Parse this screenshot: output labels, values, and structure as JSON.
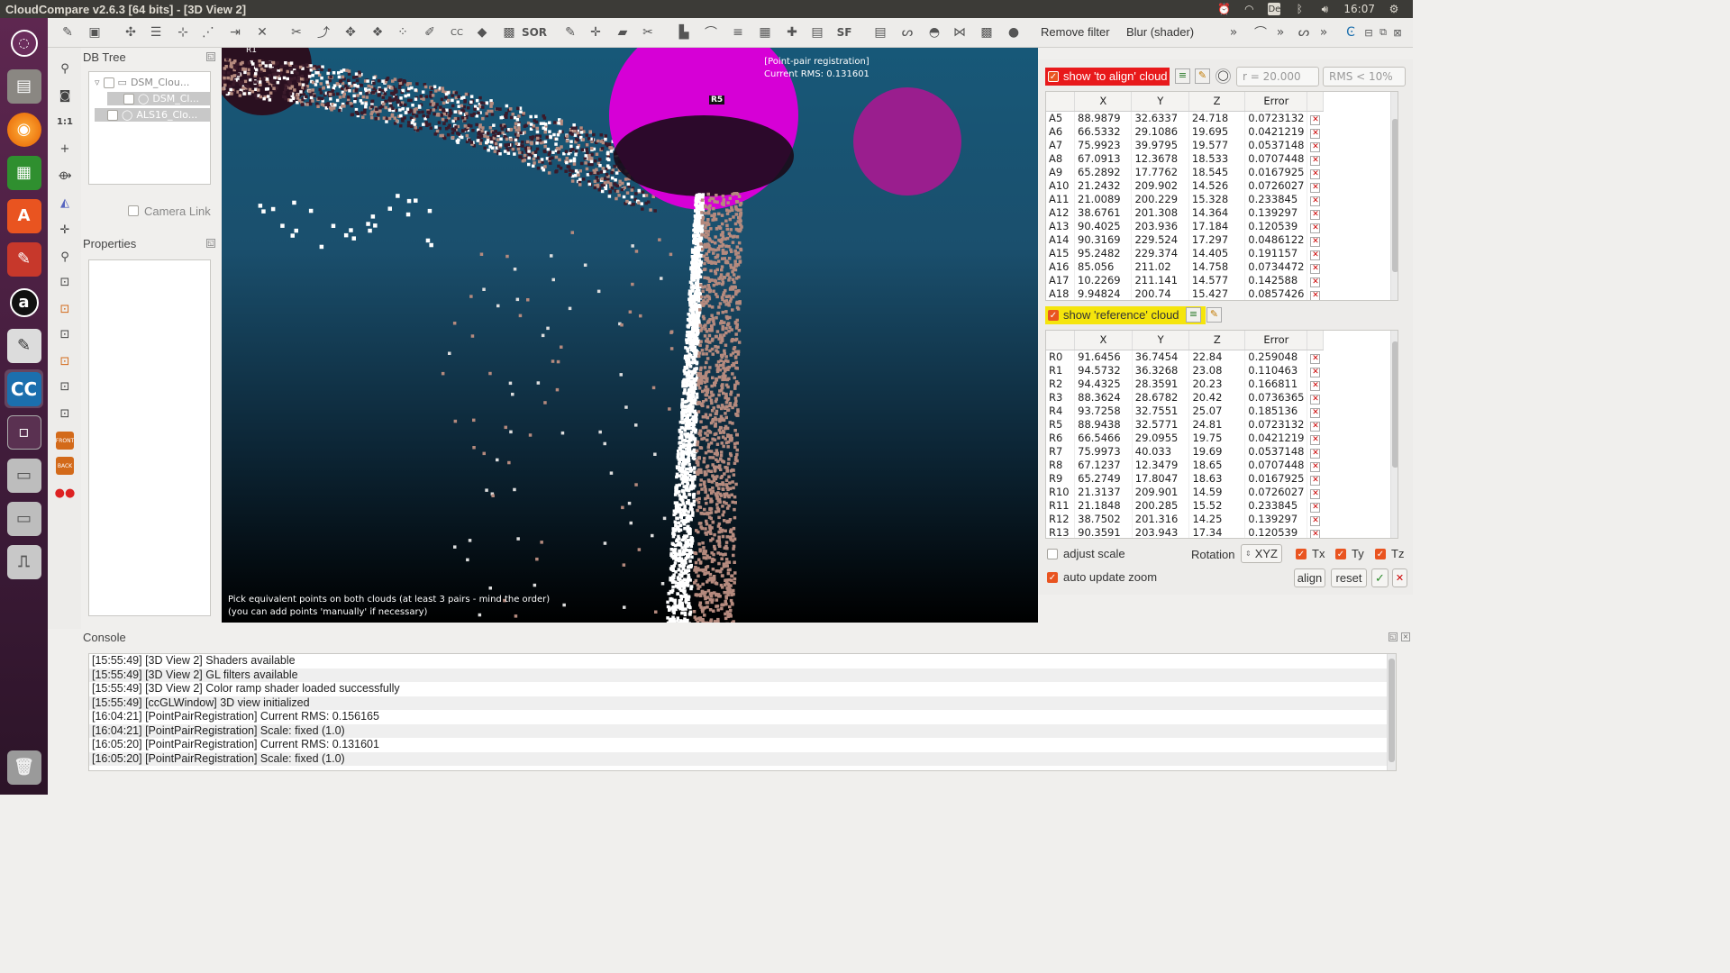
{
  "window_title": "CloudCompare v2.6.3 [64 bits] - [3D View 2]",
  "clock": "16:07",
  "keyboard_layout": "De",
  "toolbar": {
    "remove_filter": "Remove filter",
    "blur_shader": "Blur (shader)",
    "sor_label": "SOR",
    "sf_label": "SF",
    "cc_label": "CC"
  },
  "db_tree": {
    "title": "DB Tree",
    "items": [
      "DSM_Clou...",
      "DSM_Cl...",
      "ALS16_Clo..."
    ]
  },
  "camera_link": "Camera Link",
  "properties_title": "Properties",
  "side_tools": {
    "zoom_1to1": "1:1",
    "front_label": "FRONT",
    "back_label": "BACK"
  },
  "view3d": {
    "overlay_title": "[Point-pair registration]",
    "overlay_rms": "Current RMS: 0.131601",
    "hint_line1": "Pick equivalent points on both clouds (at least 3 pairs - mind the order)",
    "hint_line2": "(you can add points 'manually' if necessary)",
    "r5_label": "R5",
    "r1_label": "R1"
  },
  "registration": {
    "show_align_label": "show 'to align' cloud",
    "show_reference_label": "show 'reference' cloud",
    "radius_field": "r = 20.000",
    "rms_field": "RMS < 10%",
    "columns": [
      "X",
      "Y",
      "Z",
      "Error"
    ],
    "align_rows": [
      [
        "A5",
        "88.9879",
        "32.6337",
        "24.718",
        "0.0723132"
      ],
      [
        "A6",
        "66.5332",
        "29.1086",
        "19.695",
        "0.0421219"
      ],
      [
        "A7",
        "75.9923",
        "39.9795",
        "19.577",
        "0.0537148"
      ],
      [
        "A8",
        "67.0913",
        "12.3678",
        "18.533",
        "0.0707448"
      ],
      [
        "A9",
        "65.2892",
        "17.7762",
        "18.545",
        "0.0167925"
      ],
      [
        "A10",
        "21.2432",
        "209.902",
        "14.526",
        "0.0726027"
      ],
      [
        "A11",
        "21.0089",
        "200.229",
        "15.328",
        "0.233845"
      ],
      [
        "A12",
        "38.6761",
        "201.308",
        "14.364",
        "0.139297"
      ],
      [
        "A13",
        "90.4025",
        "203.936",
        "17.184",
        "0.120539"
      ],
      [
        "A14",
        "90.3169",
        "229.524",
        "17.297",
        "0.0486122"
      ],
      [
        "A15",
        "95.2482",
        "229.374",
        "14.405",
        "0.191157"
      ],
      [
        "A16",
        "85.056",
        "211.02",
        "14.758",
        "0.0734472"
      ],
      [
        "A17",
        "10.2269",
        "211.141",
        "14.577",
        "0.142588"
      ],
      [
        "A18",
        "9.94824",
        "200.74",
        "15.427",
        "0.0857426"
      ]
    ],
    "reference_rows": [
      [
        "R0",
        "91.6456",
        "36.7454",
        "22.84",
        "0.259048"
      ],
      [
        "R1",
        "94.5732",
        "36.3268",
        "23.08",
        "0.110463"
      ],
      [
        "R2",
        "94.4325",
        "28.3591",
        "20.23",
        "0.166811"
      ],
      [
        "R3",
        "88.3624",
        "28.6782",
        "20.42",
        "0.0736365"
      ],
      [
        "R4",
        "93.7258",
        "32.7551",
        "25.07",
        "0.185136"
      ],
      [
        "R5",
        "88.9438",
        "32.5771",
        "24.81",
        "0.0723132"
      ],
      [
        "R6",
        "66.5466",
        "29.0955",
        "19.75",
        "0.0421219"
      ],
      [
        "R7",
        "75.9973",
        "40.033",
        "19.69",
        "0.0537148"
      ],
      [
        "R8",
        "67.1237",
        "12.3479",
        "18.65",
        "0.0707448"
      ],
      [
        "R9",
        "65.2749",
        "17.8047",
        "18.63",
        "0.0167925"
      ],
      [
        "R10",
        "21.3137",
        "209.901",
        "14.59",
        "0.0726027"
      ],
      [
        "R11",
        "21.1848",
        "200.285",
        "15.52",
        "0.233845"
      ],
      [
        "R12",
        "38.7502",
        "201.316",
        "14.25",
        "0.139297"
      ],
      [
        "R13",
        "90.3591",
        "203.943",
        "17.34",
        "0.120539"
      ]
    ],
    "adjust_scale": "adjust scale",
    "rotation_label": "Rotation",
    "rotation_value": "XYZ",
    "tx": "Tx",
    "ty": "Ty",
    "tz": "Tz",
    "auto_update_zoom": "auto update zoom",
    "align_button": "align",
    "reset_button": "reset"
  },
  "console": {
    "title": "Console",
    "lines": [
      "[15:55:49] [3D View 2] Shaders available",
      "[15:55:49] [3D View 2] GL filters available",
      "[15:55:49] [3D View 2] Color ramp shader loaded successfully",
      "[15:55:49] [ccGLWindow] 3D view initialized",
      "[16:04:21] [PointPairRegistration] Current RMS: 0.156165",
      "[16:04:21] [PointPairRegistration] Scale: fixed (1.0)",
      "[16:05:20] [PointPairRegistration] Current RMS: 0.131601",
      "[16:05:20] [PointPairRegistration] Scale: fixed (1.0)"
    ]
  },
  "colors": {
    "accent": "#e95420",
    "highlight_yellow": "#f5e50c",
    "sphere_magenta": "#d600d6",
    "cloud_pink": "#b58a7e",
    "sky_blue": "#175878"
  }
}
